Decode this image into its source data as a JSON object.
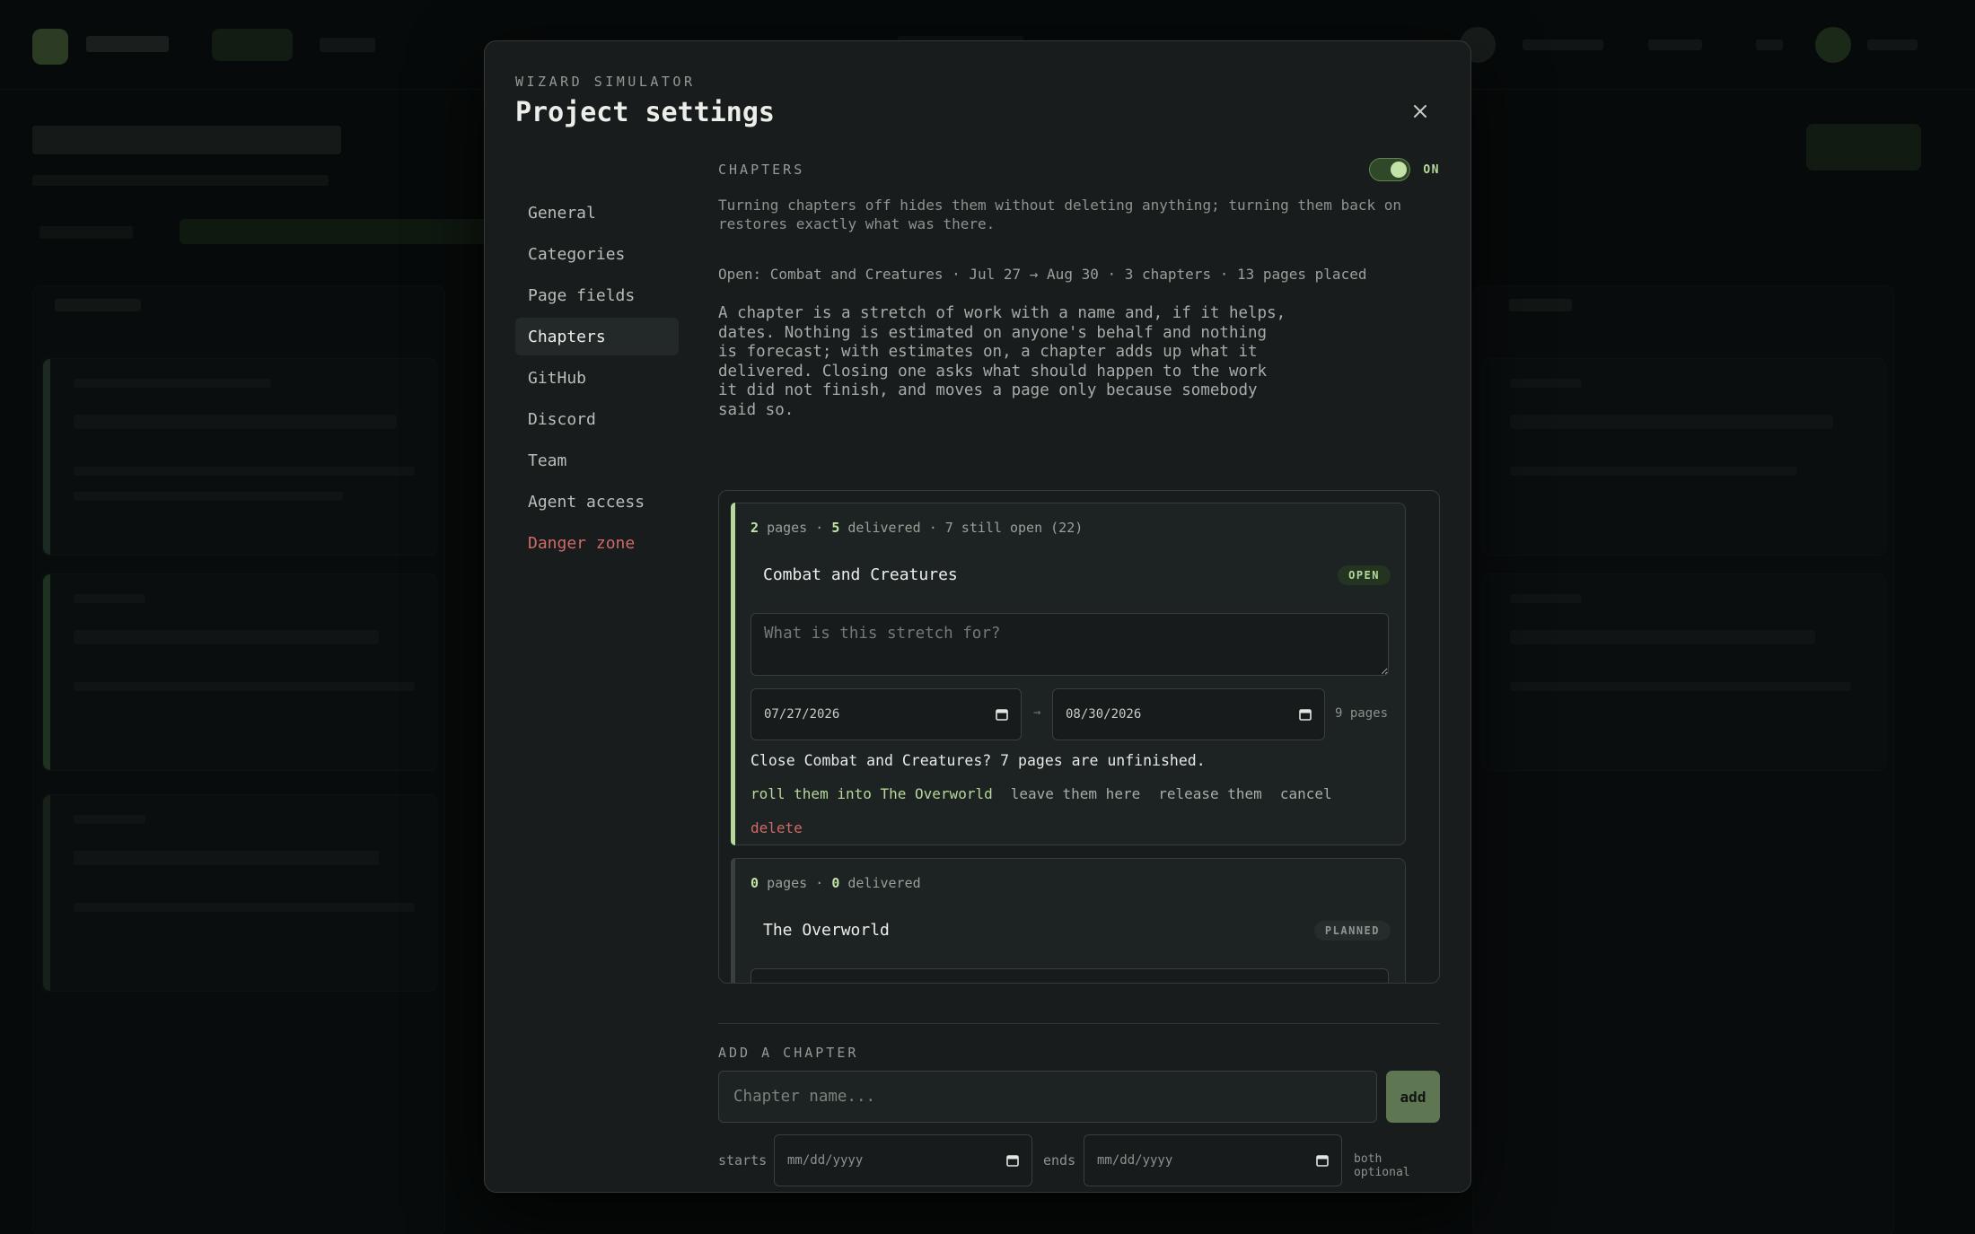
{
  "modal": {
    "eyebrow": "WIZARD SIMULATOR",
    "title": "Project settings",
    "close_icon": "close-icon"
  },
  "nav": {
    "items": [
      {
        "label": "General"
      },
      {
        "label": "Categories"
      },
      {
        "label": "Page fields"
      },
      {
        "label": "Chapters",
        "active": true
      },
      {
        "label": "GitHub"
      },
      {
        "label": "Discord"
      },
      {
        "label": "Team"
      },
      {
        "label": "Agent access"
      },
      {
        "label": "Danger zone",
        "danger": true
      }
    ]
  },
  "chapters_section": {
    "label": "CHAPTERS",
    "toggle_label": "ON",
    "toggle_on": true,
    "help": "Turning chapters off hides them without deleting anything; turning them back on restores exactly what was there.",
    "open_summary": "Open: Combat and Creatures · Jul 27 → Aug 30 · 3 chapters · 13 pages placed",
    "description": "A chapter is a stretch of work with a name and, if it helps, dates. Nothing is estimated on anyone's behalf and nothing is forecast; with estimates on, a chapter adds up what it delivered. Closing one asks what should happen to the work it did not finish, and moves a page only because somebody said so."
  },
  "chapters": [
    {
      "pages": "2",
      "pages_word": "pages",
      "delivered": "5",
      "delivered_word": "delivered",
      "extra": "· 7 still open (22)",
      "name": "Combat and Creatures",
      "status": "OPEN",
      "purpose_placeholder": "What is this stretch for?",
      "start_date": "07/27/2026",
      "end_date": "08/30/2026",
      "arrow": "→",
      "page_count": "9 pages",
      "close_prompt": "Close Combat and Creatures? 7 pages are unfinished.",
      "actions": {
        "roll": "roll them into The Overworld",
        "leave": "leave them here",
        "release": "release them",
        "cancel": "cancel"
      },
      "delete_label": "delete",
      "accent_color": "#b6d89a"
    },
    {
      "pages": "0",
      "pages_word": "pages",
      "delivered": "0",
      "delivered_word": "delivered",
      "name": "The Overworld",
      "status": "PLANNED",
      "accent_color": "#3a403f"
    }
  ],
  "add_chapter": {
    "label": "ADD A CHAPTER",
    "name_placeholder": "Chapter name...",
    "add_label": "add",
    "starts_label": "starts",
    "ends_label": "ends",
    "date_placeholder": "mm/dd/yyyy",
    "optional_note": "both optional"
  },
  "colors": {
    "accent": "#b6d89a",
    "danger": "#d06a68",
    "modal_bg": "#181c1c"
  }
}
